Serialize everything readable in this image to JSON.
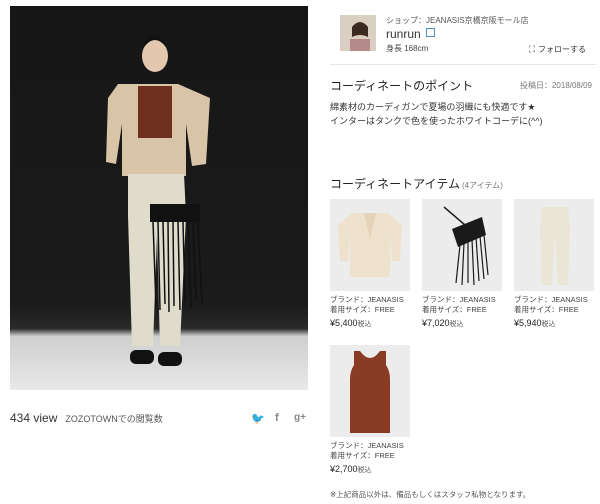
{
  "shop": {
    "shop_line": "ショップ：JEANASIS京橋京阪モール店",
    "user": "runrun",
    "height": "身長 168cm",
    "follow_label": "フォローする"
  },
  "coordinate": {
    "point_title": "コーディネートのポイント",
    "posted_date": "投稿日：2018/08/09",
    "description_line1": "綿素材のカーディガンで夏場の羽織にも快適です★",
    "description_line2": "インターはタンクで色を使ったホワイトコーデに(^^)"
  },
  "stats": {
    "views": "434 view",
    "views_label": "ZOZOTOWNでの閲覧数"
  },
  "share": {
    "twitter": "🐦",
    "facebook": "f",
    "googleplus": "g+"
  },
  "items_section": {
    "title": "コーディネートアイテム",
    "count": "(4アイテム)",
    "items": [
      {
        "brand": "ブランド：JEANASIS",
        "size": "着用サイズ：FREE",
        "price": "¥5,400",
        "tax": "税込"
      },
      {
        "brand": "ブランド：JEANASIS",
        "size": "着用サイズ：FREE",
        "price": "¥7,020",
        "tax": "税込"
      },
      {
        "brand": "ブランド：JEANASIS",
        "size": "着用サイズ：FREE",
        "price": "¥5,940",
        "tax": "税込"
      },
      {
        "brand": "ブランド：JEANASIS",
        "size": "着用サイズ：FREE",
        "price": "¥2,700",
        "tax": "税込"
      }
    ]
  },
  "footnote": "※上記商品以外は、備品もしくはスタッフ私物となります。"
}
